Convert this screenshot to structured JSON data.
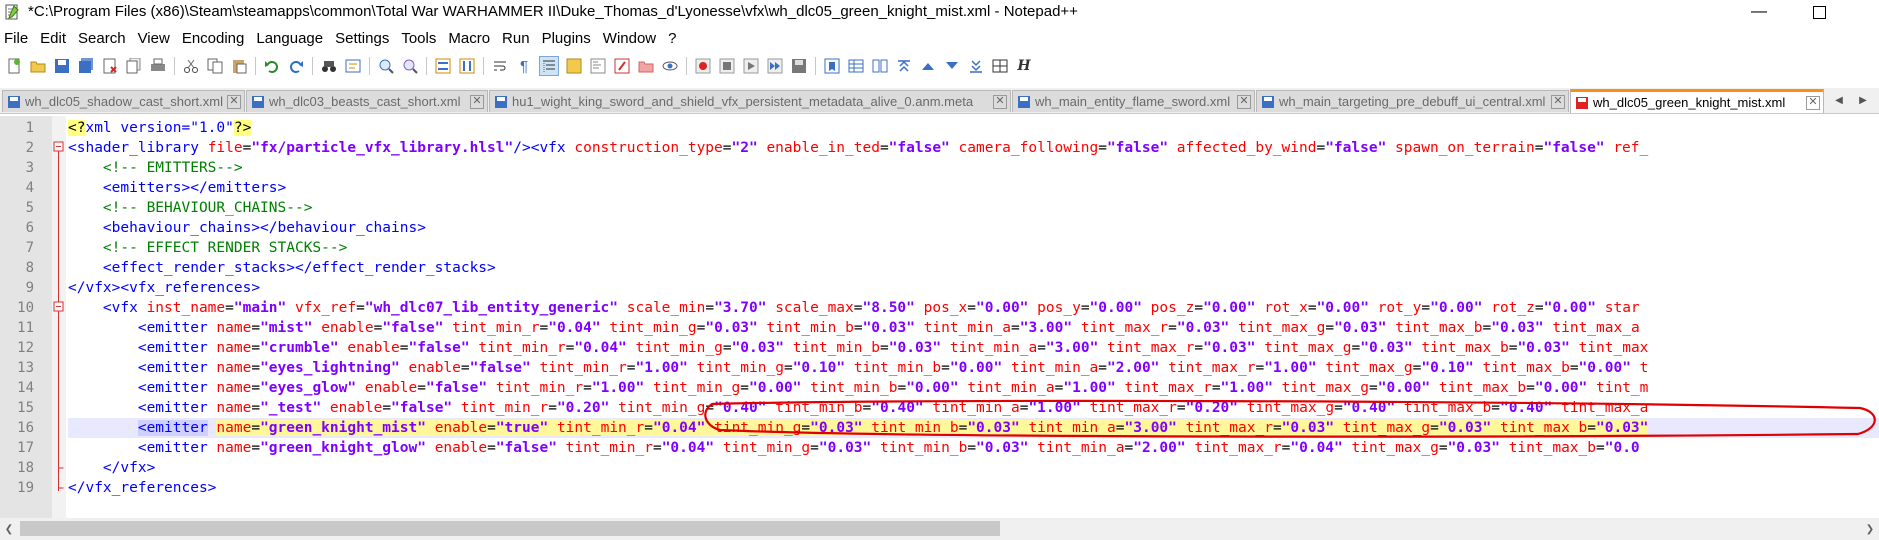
{
  "window": {
    "title": "*C:\\Program Files (x86)\\Steam\\steamapps\\common\\Total War WARHAMMER II\\Duke_Thomas_d'Lyonesse\\vfx\\wh_dlc05_green_knight_mist.xml - Notepad++"
  },
  "menu": [
    "File",
    "Edit",
    "Search",
    "View",
    "Encoding",
    "Language",
    "Settings",
    "Tools",
    "Macro",
    "Run",
    "Plugins",
    "Window",
    "?"
  ],
  "tabs": [
    {
      "label": "wh_dlc05_shadow_cast_short.xml"
    },
    {
      "label": "wh_dlc03_beasts_cast_short.xml"
    },
    {
      "label": "hu1_wight_king_sword_and_shield_vfx_persistent_metadata_alive_0.anm.meta"
    },
    {
      "label": "wh_main_entity_flame_sword.xml"
    },
    {
      "label": "wh_main_targeting_pre_debuff_ui_central.xml"
    },
    {
      "label": "wh_dlc05_green_knight_mist.xml"
    }
  ],
  "line_numbers": [
    "1",
    "2",
    "3",
    "4",
    "5",
    "6",
    "7",
    "8",
    "9",
    "10",
    "11",
    "12",
    "13",
    "14",
    "15",
    "16",
    "17",
    "18",
    "19"
  ],
  "code": {
    "l1": [
      "<?",
      "xml version=\"1.0\"",
      "?>"
    ],
    "l2": [
      "<shader_library ",
      "file",
      "=",
      "\"fx/particle_vfx_library.hlsl\"",
      "/><vfx ",
      "construction_type",
      "=",
      "\"2\"",
      " ",
      "enable_in_ted",
      "=",
      "\"false\"",
      " ",
      "camera_following",
      "=",
      "\"false\"",
      " ",
      "affected_by_wind",
      "=",
      "\"false\"",
      " ",
      "spawn_on_terrain",
      "=",
      "\"false\"",
      " ",
      "ref_"
    ],
    "l3": "<!-- EMITTERS-->",
    "l4": [
      "<emitters></emitters>"
    ],
    "l5": "<!-- BEHAVIOUR_CHAINS-->",
    "l6": [
      "<behaviour_chains></behaviour_chains>"
    ],
    "l7": "<!-- EFFECT RENDER STACKS-->",
    "l8": [
      "<effect_render_stacks></effect_render_stacks>"
    ],
    "l9": [
      "</vfx><vfx_references>"
    ],
    "l10": [
      "<vfx ",
      "inst_name",
      "=",
      "\"main\"",
      " ",
      "vfx_ref",
      "=",
      "\"wh_dlc07_lib_entity_generic\"",
      " ",
      "scale_min",
      "=",
      "\"3.70\"",
      " ",
      "scale_max",
      "=",
      "\"8.50\"",
      " ",
      "pos_x",
      "=",
      "\"0.00\"",
      " ",
      "pos_y",
      "=",
      "\"0.00\"",
      " ",
      "pos_z",
      "=",
      "\"0.00\"",
      " ",
      "rot_x",
      "=",
      "\"0.00\"",
      " ",
      "rot_y",
      "=",
      "\"0.00\"",
      " ",
      "rot_z",
      "=",
      "\"0.00\"",
      " ",
      "star"
    ],
    "l11": [
      "<emitter ",
      "name",
      "=",
      "\"mist\"",
      " ",
      "enable",
      "=",
      "\"false\"",
      " ",
      "tint_min_r",
      "=",
      "\"0.04\"",
      " ",
      "tint_min_g",
      "=",
      "\"0.03\"",
      " ",
      "tint_min_b",
      "=",
      "\"0.03\"",
      " ",
      "tint_min_a",
      "=",
      "\"3.00\"",
      " ",
      "tint_max_r",
      "=",
      "\"0.03\"",
      " ",
      "tint_max_g",
      "=",
      "\"0.03\"",
      " ",
      "tint_max_b",
      "=",
      "\"0.03\"",
      " ",
      "tint_max_a"
    ],
    "l12": [
      "<emitter ",
      "name",
      "=",
      "\"crumble\"",
      " ",
      "enable",
      "=",
      "\"false\"",
      " ",
      "tint_min_r",
      "=",
      "\"0.04\"",
      " ",
      "tint_min_g",
      "=",
      "\"0.03\"",
      " ",
      "tint_min_b",
      "=",
      "\"0.03\"",
      " ",
      "tint_min_a",
      "=",
      "\"3.00\"",
      " ",
      "tint_max_r",
      "=",
      "\"0.03\"",
      " ",
      "tint_max_g",
      "=",
      "\"0.03\"",
      " ",
      "tint_max_b",
      "=",
      "\"0.03\"",
      " ",
      "tint_max"
    ],
    "l13": [
      "<emitter ",
      "name",
      "=",
      "\"eyes_lightning\"",
      " ",
      "enable",
      "=",
      "\"false\"",
      " ",
      "tint_min_r",
      "=",
      "\"1.00\"",
      " ",
      "tint_min_g",
      "=",
      "\"0.10\"",
      " ",
      "tint_min_b",
      "=",
      "\"0.00\"",
      " ",
      "tint_min_a",
      "=",
      "\"2.00\"",
      " ",
      "tint_max_r",
      "=",
      "\"1.00\"",
      " ",
      "tint_max_g",
      "=",
      "\"0.10\"",
      " ",
      "tint_max_b",
      "=",
      "\"0.00\"",
      " ",
      "t"
    ],
    "l14": [
      "<emitter ",
      "name",
      "=",
      "\"eyes_glow\"",
      " ",
      "enable",
      "=",
      "\"false\"",
      " ",
      "tint_min_r",
      "=",
      "\"1.00\"",
      " ",
      "tint_min_g",
      "=",
      "\"0.00\"",
      " ",
      "tint_min_b",
      "=",
      "\"0.00\"",
      " ",
      "tint_min_a",
      "=",
      "\"1.00\"",
      " ",
      "tint_max_r",
      "=",
      "\"1.00\"",
      " ",
      "tint_max_g",
      "=",
      "\"0.00\"",
      " ",
      "tint_max_b",
      "=",
      "\"0.00\"",
      " ",
      "tint_m"
    ],
    "l15": [
      "<emitter ",
      "name",
      "=",
      "\"_test\"",
      " ",
      "enable",
      "=",
      "\"false\"",
      " ",
      "tint_min_r",
      "=",
      "\"0.20\"",
      " ",
      "tint_min_g",
      "=",
      "\"0.40\"",
      " ",
      "tint_min_b",
      "=",
      "\"0.40\"",
      " ",
      "tint_min_a",
      "=",
      "\"1.00\"",
      " ",
      "tint_max_r",
      "=",
      "\"0.20\"",
      " ",
      "tint_max_g",
      "=",
      "\"0.40\"",
      " ",
      "tint_max_b",
      "=",
      "\"0.40\"",
      " ",
      "tint_max_a"
    ],
    "l16": [
      "<emitter",
      " ",
      "name",
      "=",
      "\"green_knight_mist\"",
      " ",
      "enable",
      "=",
      "\"true\"",
      " ",
      "tint_min_r",
      "=",
      "\"0.04\"",
      " ",
      "tint_min_g",
      "=",
      "\"0.03\"",
      " ",
      "tint_min_b",
      "=",
      "\"0.03\"",
      " ",
      "tint_min_a",
      "=",
      "\"3.00\"",
      " ",
      "tint_max_r",
      "=",
      "\"0.03\"",
      " ",
      "tint_max_g",
      "=",
      "\"0.03\"",
      " ",
      "tint_max_b",
      "=",
      "\"0.03\""
    ],
    "l17": [
      "<emitter ",
      "name",
      "=",
      "\"green_knight_glow\"",
      " ",
      "enable",
      "=",
      "\"false\"",
      " ",
      "tint_min_r",
      "=",
      "\"0.04\"",
      " ",
      "tint_min_g",
      "=",
      "\"0.03\"",
      " ",
      "tint_min_b",
      "=",
      "\"0.03\"",
      " ",
      "tint_min_a",
      "=",
      "\"2.00\"",
      " ",
      "tint_max_r",
      "=",
      "\"0.04\"",
      " ",
      "tint_max_g",
      "=",
      "\"0.03\"",
      " ",
      "tint_max_b",
      "=",
      "\"0.0"
    ],
    "l18": [
      "</vfx>"
    ],
    "l19": [
      "</vfx_references>"
    ]
  },
  "colors": {
    "tag": "#0000ff",
    "attr": "#ff0000",
    "value": "#8000ff",
    "comment": "#008000",
    "active_tab_accent": "#ff8c1a",
    "annotation": "#e00000"
  }
}
